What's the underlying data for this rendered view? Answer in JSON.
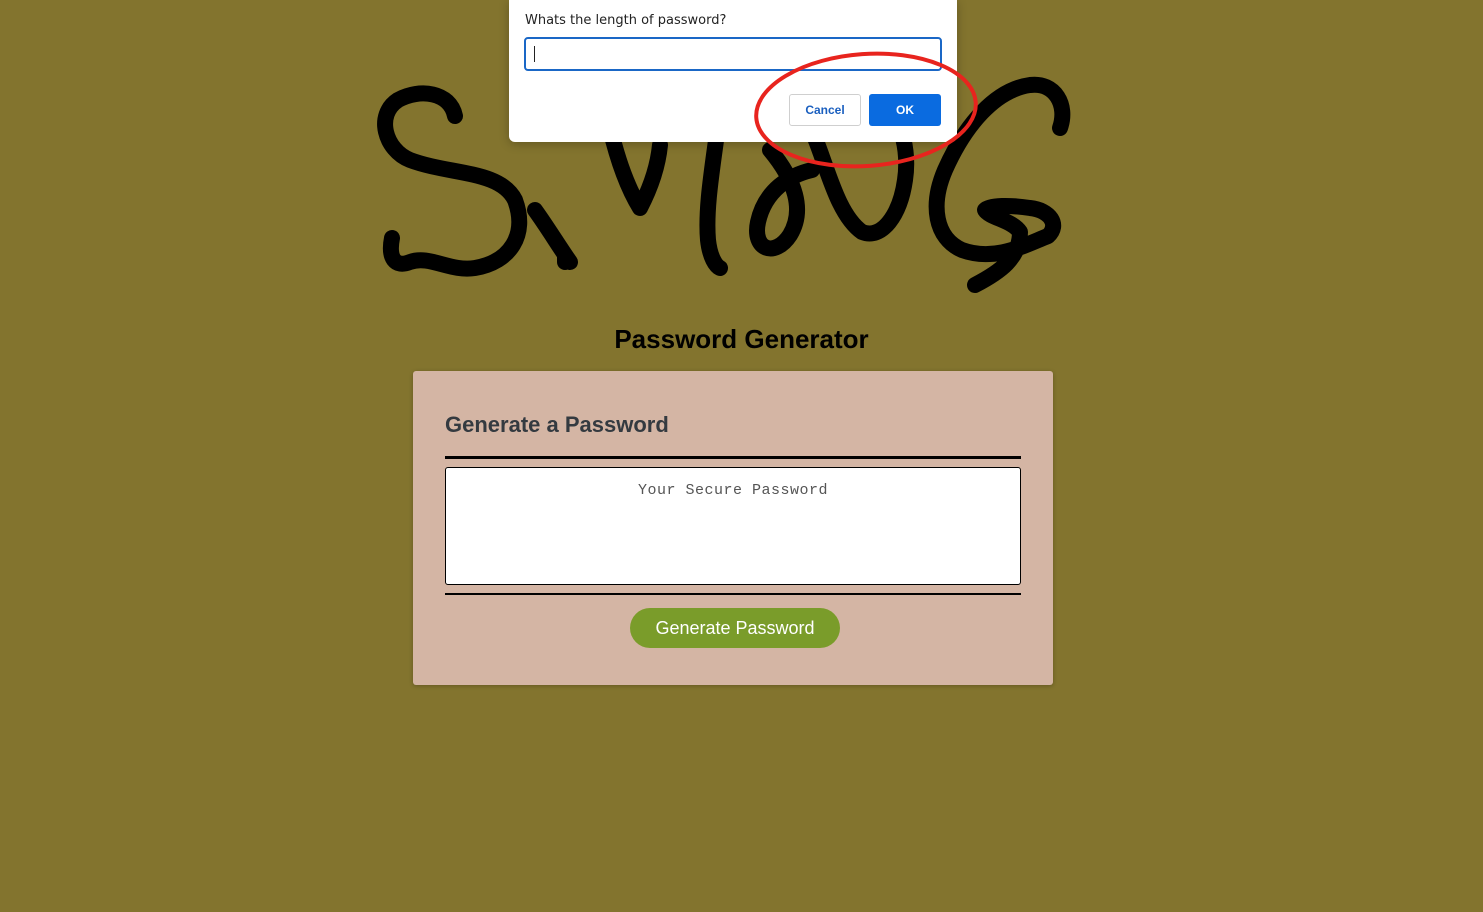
{
  "page": {
    "title": "Password Generator",
    "background_color": "#83742e"
  },
  "logo": {
    "text": "SMDDG",
    "style": "hand-drawn black scribble"
  },
  "card": {
    "header": "Generate a Password",
    "password_placeholder": "Your Secure Password",
    "password_value": "",
    "generate_button_label": "Generate Password",
    "background_color": "#d4b5a4",
    "button_color": "#7a9c2a"
  },
  "dialog": {
    "message": "Whats the length of password?",
    "input_value": "",
    "cancel_label": "Cancel",
    "ok_label": "OK",
    "ok_color": "#0a6be0"
  },
  "annotation": {
    "type": "red circle highlight",
    "target": "dialog OK and Cancel buttons",
    "color": "#e8241e"
  }
}
